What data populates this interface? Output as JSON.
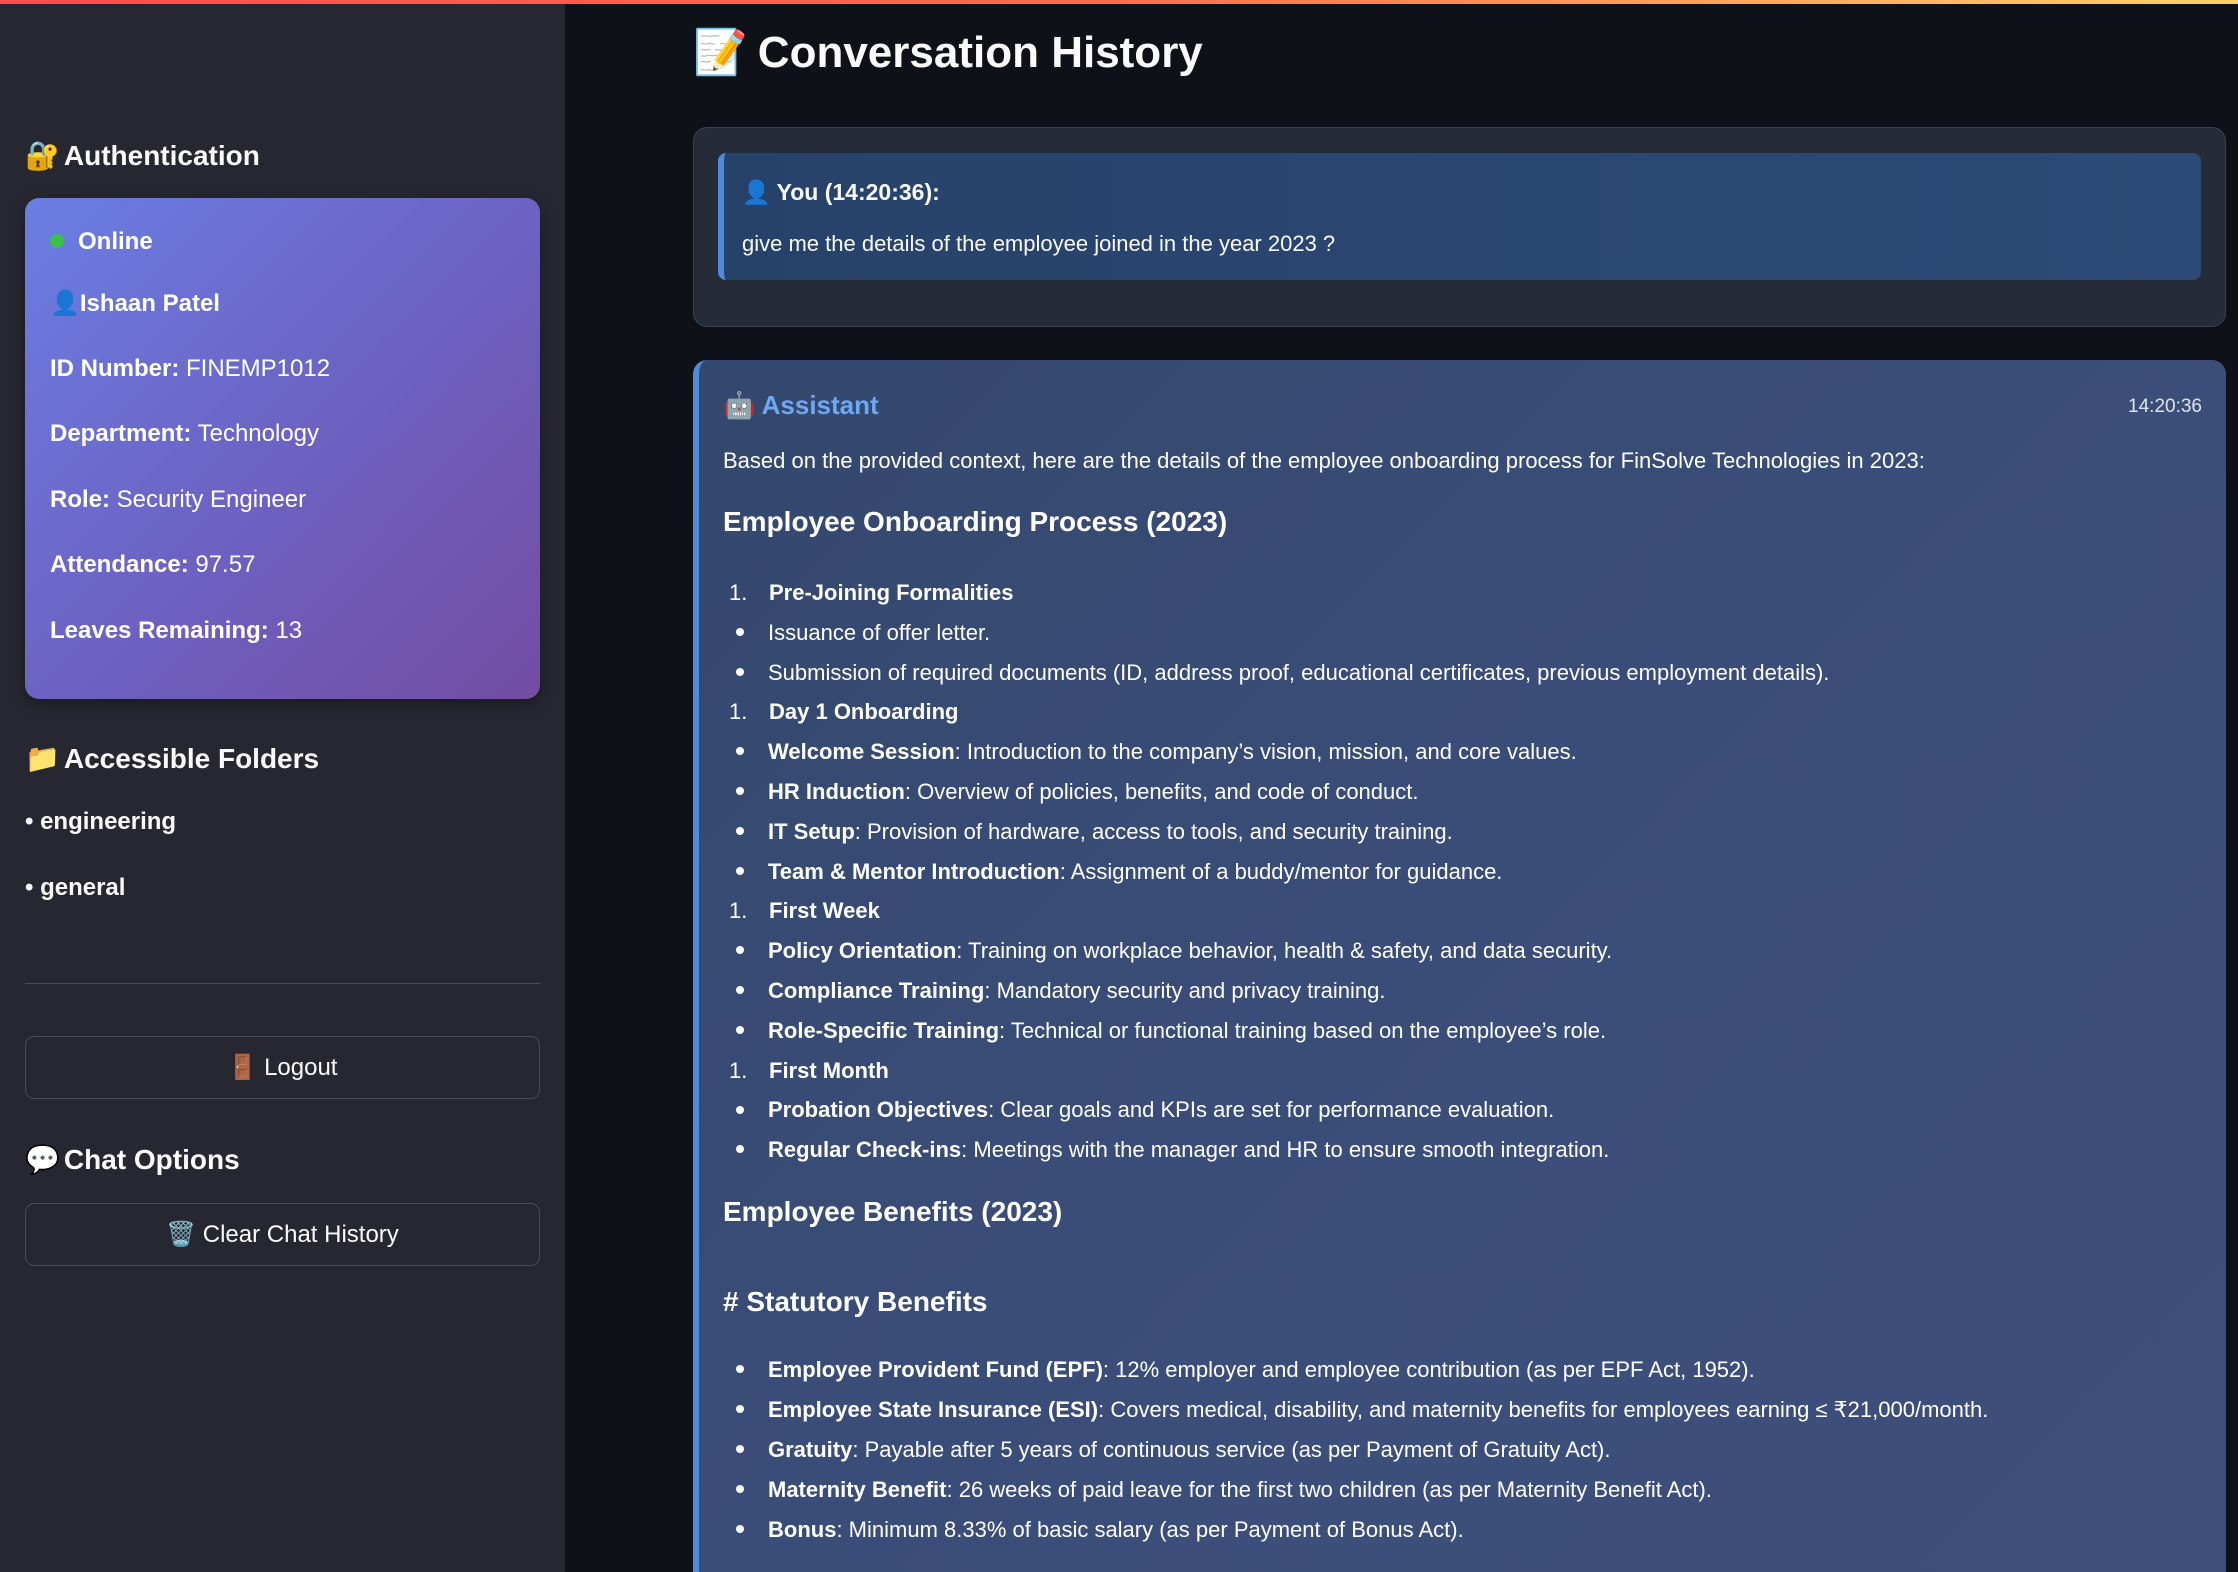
{
  "sidebar": {
    "auth_heading": "Authentication",
    "auth_emoji": "🔐",
    "status": "Online",
    "user_emoji": "👤",
    "user_name": "Ishaan Patel",
    "fields": [
      {
        "label": "ID Number:",
        "value": "FINEMP1012"
      },
      {
        "label": "Department:",
        "value": "Technology"
      },
      {
        "label": "Role:",
        "value": "Security Engineer"
      },
      {
        "label": "Attendance:",
        "value": "97.57"
      },
      {
        "label": "Leaves Remaining:",
        "value": "13"
      }
    ],
    "folders_heading": "Accessible Folders",
    "folders_emoji": "📁",
    "folders": [
      "• engineering",
      "• general"
    ],
    "logout_label": "🚪 Logout",
    "chat_options_heading": "Chat Options",
    "chat_options_emoji": "💬",
    "clear_label": "🗑️ Clear Chat History"
  },
  "main": {
    "title_emoji": "📝",
    "title": "Conversation History",
    "user_message": {
      "header": "👤 You (14:20:36):",
      "text": "give me the details of the employee joined in the year 2023 ?"
    },
    "assistant": {
      "header": "🤖 Assistant",
      "time": "14:20:36",
      "intro": "Based on the provided context, here are the details of the employee onboarding process for FinSolve Technologies in 2023:",
      "section1": "Employee Onboarding Process (2023)",
      "list1": [
        {
          "type": "num",
          "bold": "Pre-Joining Formalities",
          "text": ""
        },
        {
          "type": "bullet",
          "bold": "",
          "text": "Issuance of offer letter."
        },
        {
          "type": "bullet",
          "bold": "",
          "text": "Submission of required documents (ID, address proof, educational certificates, previous employment details)."
        },
        {
          "type": "num",
          "bold": "Day 1 Onboarding",
          "text": ""
        },
        {
          "type": "bullet",
          "bold": "Welcome Session",
          "text": ": Introduction to the company’s vision, mission, and core values."
        },
        {
          "type": "bullet",
          "bold": "HR Induction",
          "text": ": Overview of policies, benefits, and code of conduct."
        },
        {
          "type": "bullet",
          "bold": "IT Setup",
          "text": ": Provision of hardware, access to tools, and security training."
        },
        {
          "type": "bullet",
          "bold": "Team & Mentor Introduction",
          "text": ": Assignment of a buddy/mentor for guidance."
        },
        {
          "type": "num",
          "bold": "First Week",
          "text": ""
        },
        {
          "type": "bullet",
          "bold": "Policy Orientation",
          "text": ": Training on workplace behavior, health & safety, and data security."
        },
        {
          "type": "bullet",
          "bold": "Compliance Training",
          "text": ": Mandatory security and privacy training."
        },
        {
          "type": "bullet",
          "bold": "Role-Specific Training",
          "text": ": Technical or functional training based on the employee’s role."
        },
        {
          "type": "num",
          "bold": "First Month",
          "text": ""
        },
        {
          "type": "bullet",
          "bold": "Probation Objectives",
          "text": ": Clear goals and KPIs are set for performance evaluation."
        },
        {
          "type": "bullet",
          "bold": "Regular Check-ins",
          "text": ": Meetings with the manager and HR to ensure smooth integration."
        }
      ],
      "section2": "Employee Benefits (2023)",
      "section3": "# Statutory Benefits",
      "list2": [
        {
          "type": "bullet",
          "bold": "Employee Provident Fund (EPF)",
          "text": ": 12% employer and employee contribution (as per EPF Act, 1952)."
        },
        {
          "type": "bullet",
          "bold": "Employee State Insurance (ESI)",
          "text": ": Covers medical, disability, and maternity benefits for employees earning ≤ ₹21,000/month."
        },
        {
          "type": "bullet",
          "bold": "Gratuity",
          "text": ": Payable after 5 years of continuous service (as per Payment of Gratuity Act)."
        },
        {
          "type": "bullet",
          "bold": "Maternity Benefit",
          "text": ": 26 weeks of paid leave for the first two children (as per Maternity Benefit Act)."
        },
        {
          "type": "bullet",
          "bold": "Bonus",
          "text": ": Minimum 8.33% of basic salary (as per Payment of Bonus Act)."
        }
      ]
    }
  },
  "colors": {
    "app_bg": "#0e1117",
    "sidebar_bg": "#262730",
    "accent_blue": "#4f8bd8",
    "assistant_label": "#6fa8f2",
    "status_online": "#39c24a"
  }
}
